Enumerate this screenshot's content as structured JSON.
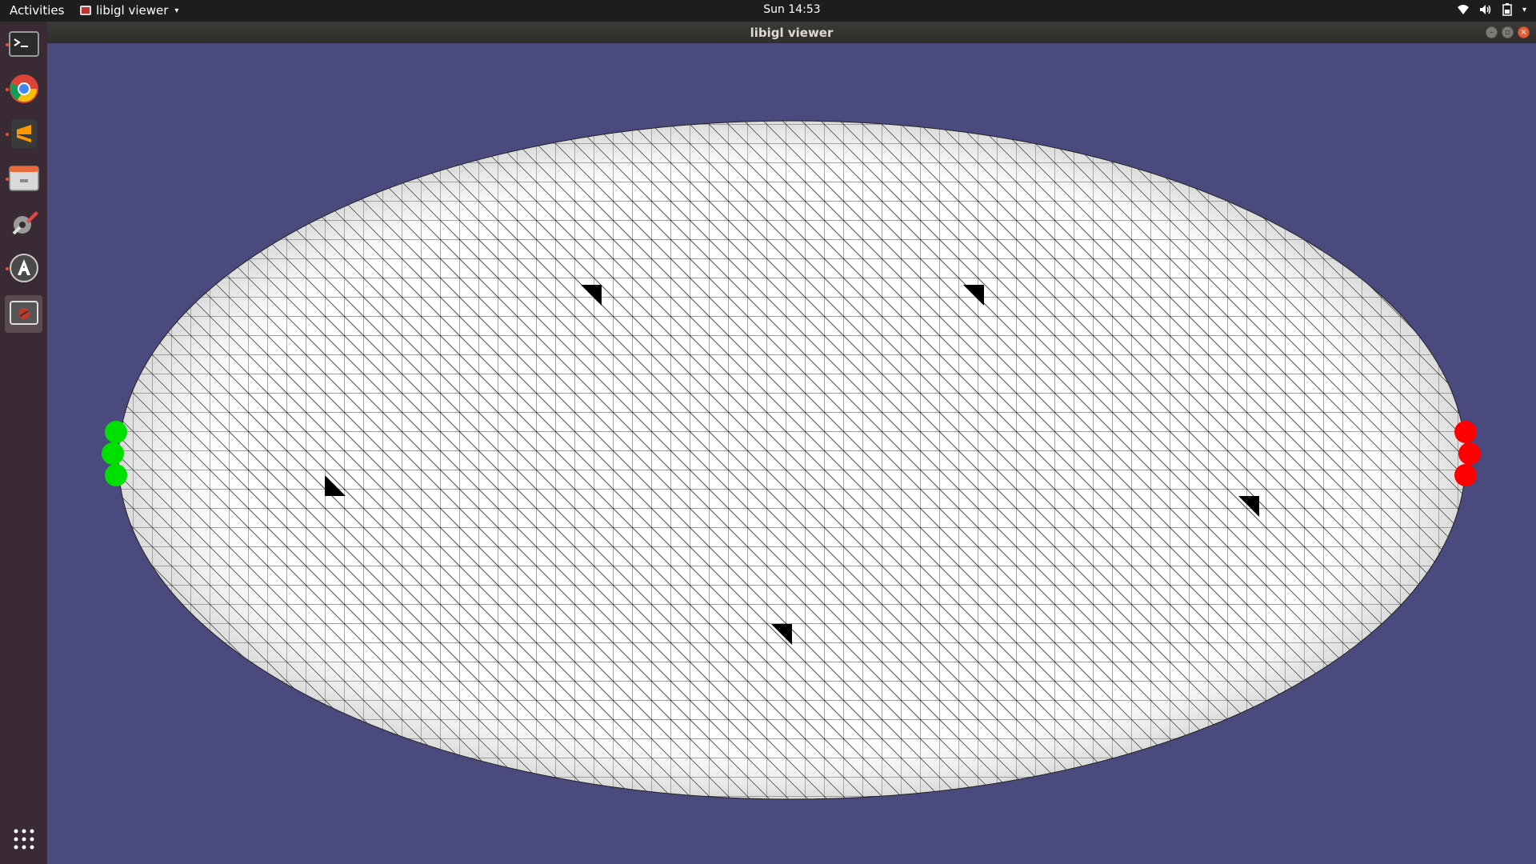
{
  "topbar": {
    "activities_label": "Activities",
    "app_menu_label": "libigl viewer",
    "clock": "Sun 14:53"
  },
  "window": {
    "title": "libigl viewer"
  },
  "dock": {
    "items": [
      {
        "name": "terminal",
        "icon": "terminal-icon",
        "running": true
      },
      {
        "name": "chrome",
        "icon": "chrome-icon",
        "running": true
      },
      {
        "name": "sublime-text",
        "icon": "sublime-icon",
        "running": true
      },
      {
        "name": "files",
        "icon": "files-icon",
        "running": true
      },
      {
        "name": "system-settings",
        "icon": "settings-icon",
        "running": false
      },
      {
        "name": "software-updater",
        "icon": "updater-icon",
        "running": true
      },
      {
        "name": "libigl-viewer",
        "icon": "viewer-icon",
        "running": false,
        "active": true
      }
    ],
    "show_apps_icon": "grid-icon"
  },
  "viewer": {
    "background_color": "#4a4a7e",
    "mesh_fill": "#ffffff",
    "edge_color": "#000000",
    "fixed_constraint_color": "#00e000",
    "handle_constraint_color": "#ff0000",
    "marker_color": "#000000"
  }
}
